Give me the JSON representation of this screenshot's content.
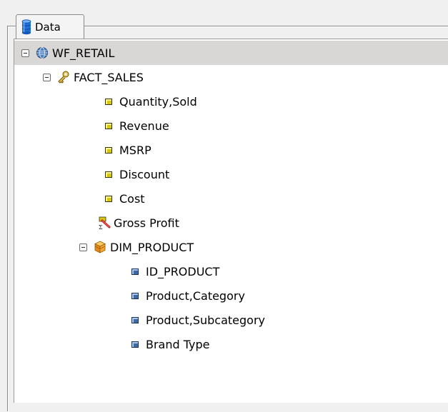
{
  "panel": {
    "tab_label": "Data",
    "tab_icon": "database-icon"
  },
  "tree": {
    "root": {
      "label": "WF_RETAIL",
      "icon": "globe-icon",
      "expanded": true,
      "selected": true
    },
    "fact_sales": {
      "label": "FACT_SALES",
      "icon": "key-icon",
      "expanded": true
    },
    "measures": [
      {
        "label": "Quantity,Sold",
        "icon": "measure-icon"
      },
      {
        "label": "Revenue",
        "icon": "measure-icon"
      },
      {
        "label": "MSRP",
        "icon": "measure-icon"
      },
      {
        "label": "Discount",
        "icon": "measure-icon"
      },
      {
        "label": "Cost",
        "icon": "measure-icon"
      },
      {
        "label": "Gross Profit",
        "icon": "calculated-field-icon"
      }
    ],
    "dim_product": {
      "label": "DIM_PRODUCT",
      "icon": "dimension-icon",
      "expanded": true
    },
    "dimension_fields": [
      {
        "label": "ID_PRODUCT",
        "icon": "dimension-field-icon"
      },
      {
        "label": "Product,Category",
        "icon": "dimension-field-icon"
      },
      {
        "label": "Product,Subcategory",
        "icon": "dimension-field-icon"
      },
      {
        "label": "Brand Type",
        "icon": "dimension-field-icon"
      }
    ]
  },
  "colors": {
    "selected_row": "#d9d6d6",
    "measure_icon": "#d8c80a",
    "dimension_field_icon": "#3e6aa8"
  }
}
